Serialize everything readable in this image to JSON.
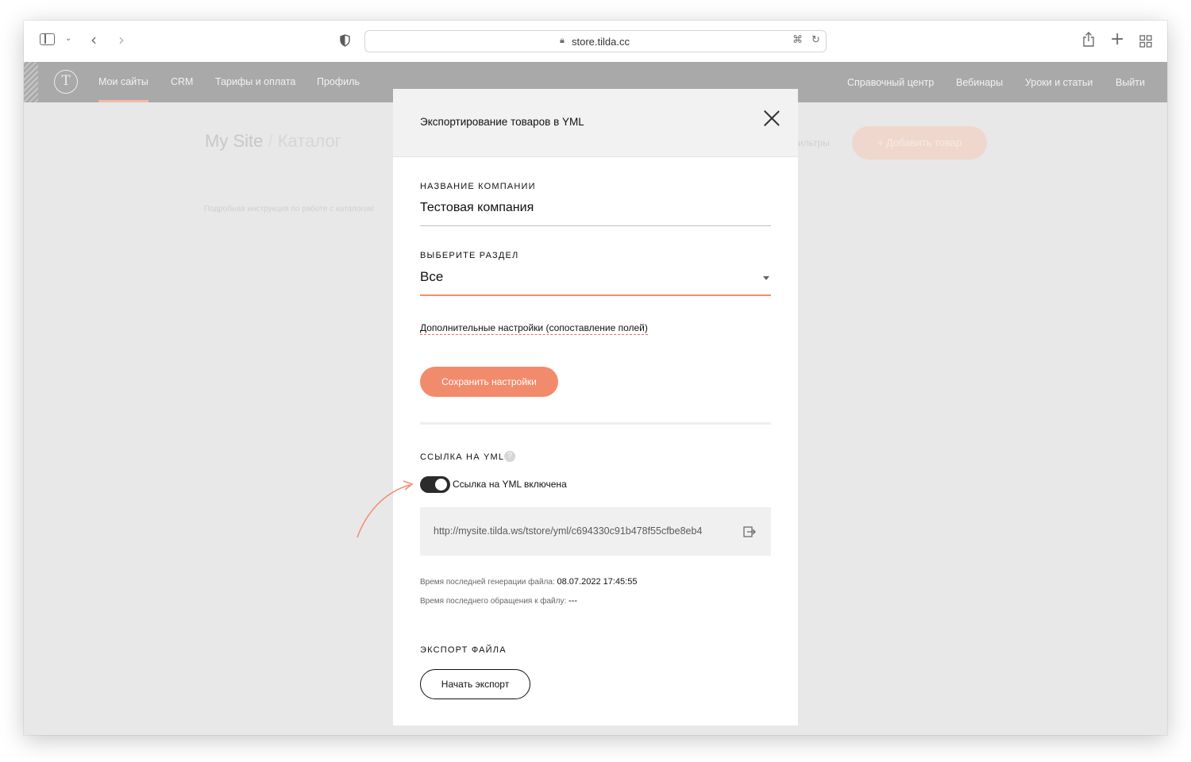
{
  "browser": {
    "url": "store.tilda.cc"
  },
  "nav": {
    "left_items": [
      "Мои сайты",
      "CRM",
      "Тарифы и оплата",
      "Профиль"
    ],
    "right_items": [
      "Справочный центр",
      "Вебинары",
      "Уроки и статьи",
      "Выйти"
    ]
  },
  "background": {
    "title_site": "My Site",
    "title_sep": "/",
    "title_page": "Каталог",
    "hint": "Подробная инструкция по работе с каталогом",
    "filters": "ильтры",
    "add_button": "+ Добавить товар"
  },
  "modal": {
    "title": "Экспортирование товаров в YML",
    "company": {
      "label": "НАЗВАНИЕ КОМПАНИИ",
      "value": "Тестовая компания"
    },
    "section": {
      "label": "ВЫБЕРИТЕ РАЗДЕЛ",
      "value": "Все"
    },
    "advanced_link": "Дополнительные настройки (сопоставление полей)",
    "save_button": "Сохранить настройки",
    "yml_link": {
      "label": "ССЫЛКА НА YML",
      "help": "?",
      "toggle_label": "Ссылка на YML включена",
      "toggle_on": true,
      "url": "http://mysite.tilda.ws/tstore/yml/c694330c91b478f55cfbe8eb4"
    },
    "last_generated_label": "Время последней генерации файла:",
    "last_generated_value": "08.07.2022 17:45:55",
    "last_access_label": "Время последнего обращения к файлу:",
    "last_access_value": "---",
    "export": {
      "label": "ЭКСПОРТ ФАЙЛА",
      "button": "Начать экспорт"
    }
  },
  "colors": {
    "accent": "#f28b6c",
    "nav_bg": "#a9a9a9",
    "overlay_bg": "#e8e8e8"
  }
}
